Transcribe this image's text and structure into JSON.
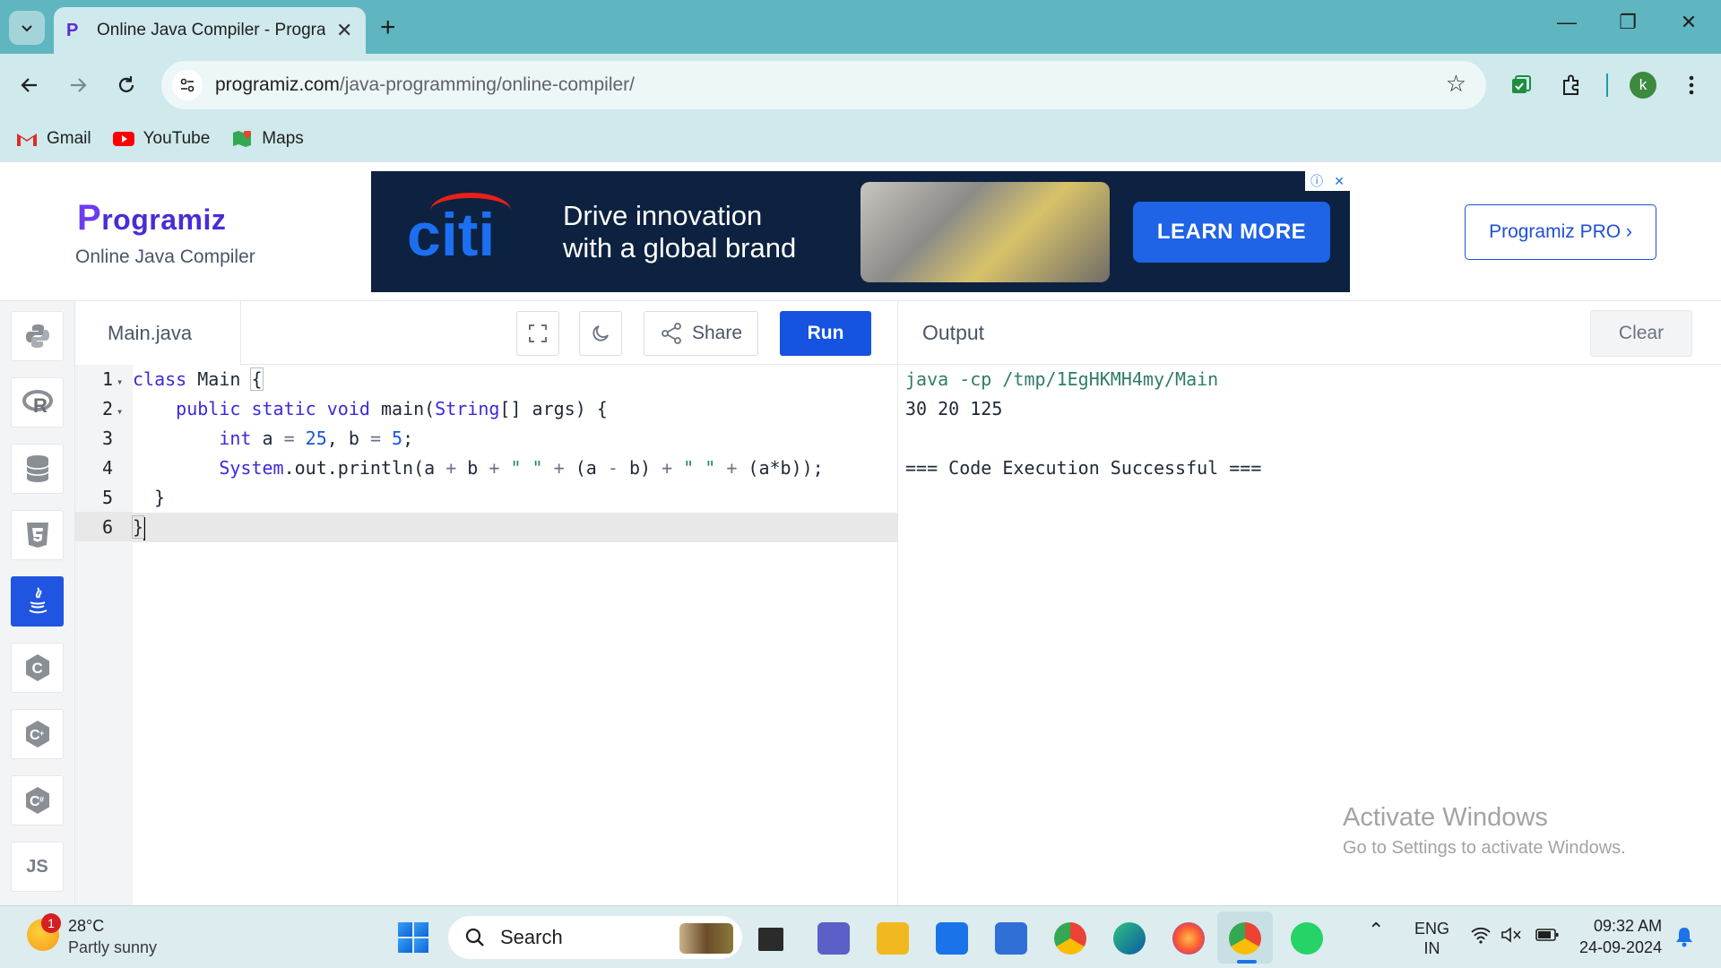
{
  "browser": {
    "tab_title": "Online Java Compiler - Programiz",
    "url_host": "programiz.com",
    "url_path": "/java-programming/online-compiler/",
    "profile_initial": "k",
    "bookmarks": [
      {
        "label": "Gmail",
        "icon": "gmail-icon"
      },
      {
        "label": "YouTube",
        "icon": "youtube-icon"
      },
      {
        "label": "Maps",
        "icon": "maps-icon"
      }
    ]
  },
  "header": {
    "logo_first": "P",
    "logo_rest": "rogramiz",
    "subtitle": "Online Java Compiler",
    "pro_button": "Programiz PRO ›"
  },
  "ad": {
    "brand": "citi",
    "headline_1": "Drive innovation",
    "headline_2": "with a global brand",
    "cta": "LEARN MORE",
    "choices_icon": "ⓘ",
    "close_icon": "✕"
  },
  "sidebar": {
    "languages": [
      {
        "name": "python",
        "glyph": "🐍",
        "active": false
      },
      {
        "name": "r",
        "glyph": "R",
        "active": false
      },
      {
        "name": "sql",
        "glyph": "▤",
        "active": false
      },
      {
        "name": "html",
        "glyph": "5",
        "active": false
      },
      {
        "name": "java",
        "glyph": "♨",
        "active": true
      },
      {
        "name": "c",
        "glyph": "C",
        "active": false
      },
      {
        "name": "cpp",
        "glyph": "C",
        "active": false
      },
      {
        "name": "csharp",
        "glyph": "C",
        "active": false
      },
      {
        "name": "javascript",
        "glyph": "JS",
        "active": false
      }
    ]
  },
  "editor": {
    "filename": "Main.java",
    "share_label": "Share",
    "run_label": "Run",
    "line_numbers": [
      "1",
      "2",
      "3",
      "4",
      "5",
      "6"
    ],
    "fold_markers": [
      "▾",
      "▾"
    ]
  },
  "output": {
    "title": "Output",
    "clear_label": "Clear",
    "lines": [
      "java -cp /tmp/1EgHKMH4my/Main",
      "30 20 125",
      "",
      "=== Code Execution Successful ==="
    ]
  },
  "watermark": {
    "line1": "Activate Windows",
    "line2": "Go to Settings to activate Windows."
  },
  "taskbar": {
    "weather_temp": "28°C",
    "weather_desc": "Partly sunny",
    "weather_badge": "1",
    "search_label": "Search",
    "lang_1": "ENG",
    "lang_2": "IN",
    "time": "09:32 AM",
    "date": "24-09-2024"
  },
  "colors": {
    "accent": "#1553e0",
    "chrome_frame": "#5fb6c0",
    "chrome_toolbar": "#cfe9ec"
  }
}
